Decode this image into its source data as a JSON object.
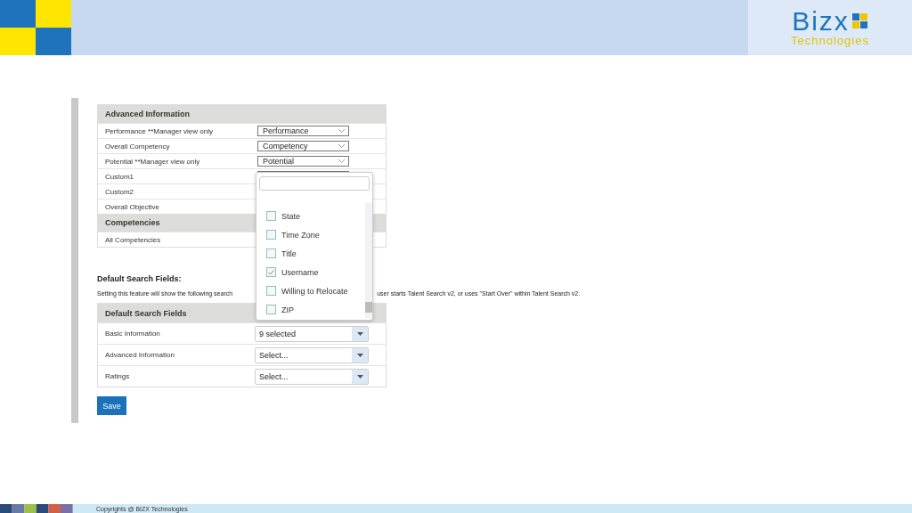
{
  "header": {
    "logo_name": "Bizx",
    "logo_tagline": "Technologies"
  },
  "advanced_information": {
    "title": "Advanced Information",
    "rows": [
      {
        "label": "Performance **Manager view only",
        "kind": "select",
        "value": "Performance"
      },
      {
        "label": "Overall Competency",
        "kind": "select",
        "value": "Competency"
      },
      {
        "label": "Potential **Manager view only",
        "kind": "select",
        "value": "Potential"
      },
      {
        "label": "Custom1",
        "kind": "select"
      },
      {
        "label": "Custom2",
        "kind": "plain"
      },
      {
        "label": "Overall Objective",
        "kind": "plain"
      }
    ]
  },
  "competencies": {
    "title": "Competencies",
    "rows": [
      {
        "label": "All Competencies"
      }
    ]
  },
  "dropdown": {
    "options": [
      {
        "label": "State",
        "checked": false
      },
      {
        "label": "Time Zone",
        "checked": false
      },
      {
        "label": "Title",
        "checked": false
      },
      {
        "label": "Username",
        "checked": true
      },
      {
        "label": "Willing to Relocate",
        "checked": false
      },
      {
        "label": "ZIP",
        "checked": false
      }
    ]
  },
  "default_search": {
    "heading": "Default Search Fields:",
    "description_start": "Setting this feature will show the following search",
    "description_end": "user starts Talent Search v2, or uses \"Start Over\" within Talent Search v2.",
    "table_title": "Default Search Fields",
    "rows": [
      {
        "label": "Basic Information",
        "value": "9 selected"
      },
      {
        "label": "Advanced Information",
        "value": "Select..."
      },
      {
        "label": "Ratings",
        "value": "Select..."
      }
    ]
  },
  "save_button": "Save",
  "footer": "Copyrights @ BIZX Technologies"
}
